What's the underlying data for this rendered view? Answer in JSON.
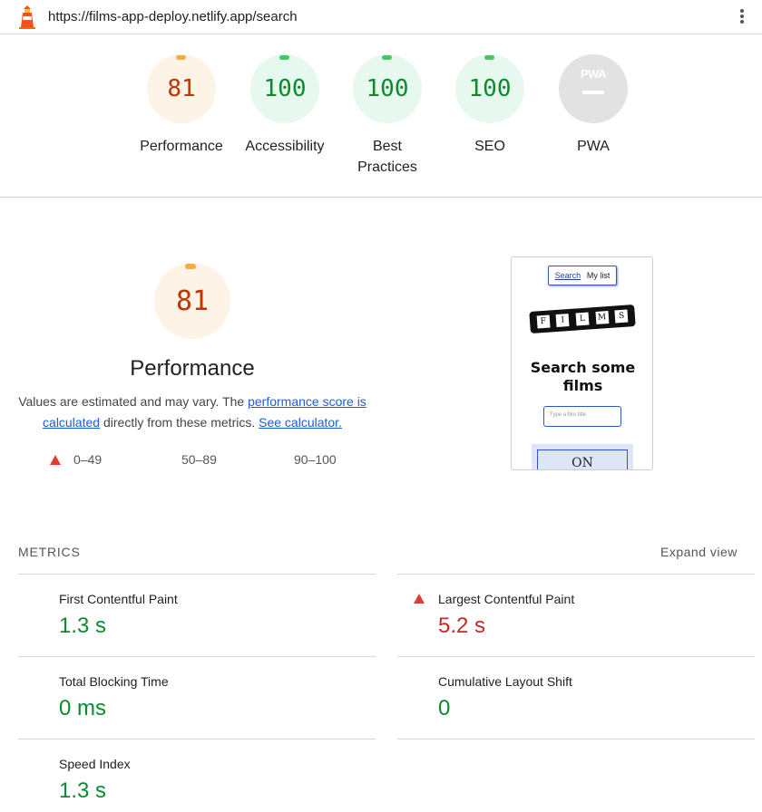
{
  "browser": {
    "url": "https://films-app-deploy.netlify.app/search"
  },
  "summary": {
    "gauges": [
      {
        "label": "Performance",
        "score": "81",
        "status": "average"
      },
      {
        "label": "Accessibility",
        "score": "100",
        "status": "pass"
      },
      {
        "label": "Best Practices",
        "score": "100",
        "status": "pass"
      },
      {
        "label": "SEO",
        "score": "100",
        "status": "pass"
      },
      {
        "label": "PWA",
        "score": "",
        "status": "na"
      }
    ]
  },
  "performance": {
    "score": "81",
    "title": "Performance",
    "desc_prefix": "Values are estimated and may vary. The ",
    "score_link": "performance score is calculated",
    "desc_middle": " directly from these metrics. ",
    "calc_link": "See calculator.",
    "legend": [
      "0–49",
      "50–89",
      "90–100"
    ]
  },
  "thumbnail": {
    "nav_search": "Search",
    "nav_mylist": "My list",
    "logo_letters": [
      "F",
      "I",
      "L",
      "M",
      "S"
    ],
    "heading": "Search some films",
    "input_placeholder": "Type a film title",
    "button_text": "ON"
  },
  "metrics": {
    "heading": "METRICS",
    "expand": "Expand view",
    "items": [
      {
        "name": "First Contentful Paint",
        "value": "1.3 s",
        "status": "pass"
      },
      {
        "name": "Largest Contentful Paint",
        "value": "5.2 s",
        "status": "fail"
      },
      {
        "name": "Total Blocking Time",
        "value": "0 ms",
        "status": "pass"
      },
      {
        "name": "Cumulative Layout Shift",
        "value": "0",
        "status": "pass"
      },
      {
        "name": "Speed Index",
        "value": "1.3 s",
        "status": "pass"
      }
    ]
  },
  "colors": {
    "average": "#c33300",
    "pass": "#0d8a2e",
    "fail": "#c62828",
    "link": "#1a5fd8"
  },
  "icons": {
    "logo": "lighthouse-icon",
    "menu": "kebab-menu-icon",
    "fail": "red-triangle-icon"
  }
}
